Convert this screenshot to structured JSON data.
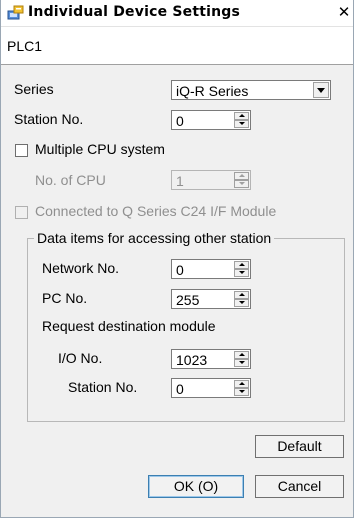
{
  "window": {
    "title": "Individual Device Settings",
    "close_glyph": "✕"
  },
  "header": {
    "device": "PLC1"
  },
  "series": {
    "label": "Series",
    "value": "iQ-R Series"
  },
  "station": {
    "label": "Station No.",
    "value": "0"
  },
  "multi_cpu": {
    "label": "Multiple CPU system",
    "checked": false
  },
  "cpu_count": {
    "label": "No. of CPU",
    "value": "1",
    "disabled": true
  },
  "c24": {
    "label": "Connected to Q Series C24 I/F Module",
    "checked": false,
    "disabled": true
  },
  "group": {
    "title": "Data items for accessing other station",
    "network": {
      "label": "Network No.",
      "value": "0"
    },
    "pc": {
      "label": "PC No.",
      "value": "255"
    },
    "request_label": "Request destination module",
    "io": {
      "label": "I/O No.",
      "value": "1023"
    },
    "dest_station": {
      "label": "Station No.",
      "value": "0"
    }
  },
  "buttons": {
    "default": "Default",
    "ok": "OK (O)",
    "cancel": "Cancel"
  },
  "icons": {
    "title_icon": "device-settings-icon"
  }
}
